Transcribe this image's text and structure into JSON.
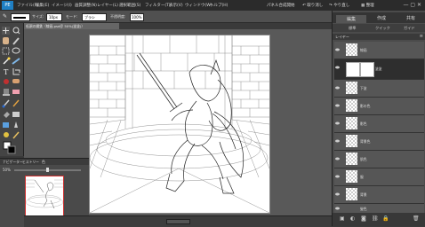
{
  "app": {
    "logo": "PE"
  },
  "menubar": {
    "items": [
      "ファイル(F)",
      "編集(E)",
      "イメージ(I)",
      "画質調整(N)",
      "レイヤー(L)",
      "選択範囲(S)",
      "フィルター(T)",
      "表示(V)",
      "ウィンドウ(W)",
      "ヘルプ(H)"
    ],
    "right": {
      "partner": "パネル合成開始",
      "undo": "取り消し",
      "redo": "やり直し",
      "organizer": "整理"
    },
    "window_controls": "— ▢ ✕"
  },
  "options": {
    "size_label": "サイズ:",
    "size_value": "10px",
    "mode_label": "モード:",
    "mode_value": "ブラシ",
    "opacity_label": "不透明度:",
    "opacity_value": "100%"
  },
  "document": {
    "tab_title": "低頭の鋼鉄（線画.psd＠ 50%(塗塗)）"
  },
  "navigator": {
    "tabs": [
      "ナビゲーター",
      "ヒストリー",
      "色"
    ],
    "zoom": "50%"
  },
  "right_panel": {
    "tabs": [
      "編集",
      "作成",
      "共有"
    ],
    "subtabs": [
      "標準",
      "クイック",
      "ガイド"
    ],
    "layers_title": "レイヤー",
    "layers": [
      {
        "name": "線画",
        "active": false
      },
      {
        "name": "塗塗",
        "active": true
      },
      {
        "name": "下塗",
        "active": false
      },
      {
        "name": "影の色",
        "active": false
      },
      {
        "name": "影色",
        "active": false
      },
      {
        "name": "背景色",
        "active": false
      },
      {
        "name": "肌色",
        "active": false
      },
      {
        "name": "服",
        "active": false
      },
      {
        "name": "背景",
        "active": false
      },
      {
        "name": "髪色",
        "active": false
      },
      {
        "name": "背景",
        "active": false
      }
    ]
  },
  "colors": {
    "accent": "#1f7fc4",
    "panel": "#4b4b4b",
    "canvas_bg": "#595959"
  }
}
